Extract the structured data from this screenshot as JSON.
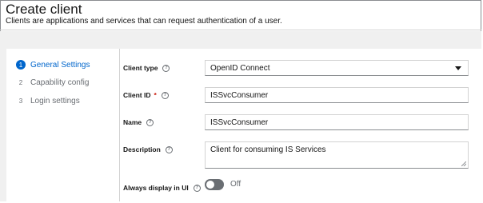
{
  "header": {
    "title": "Create client",
    "subtitle": "Clients are applications and services that can request authentication of a user."
  },
  "wizard": {
    "steps": [
      {
        "number": "1",
        "label": "General Settings",
        "active": true
      },
      {
        "number": "2",
        "label": "Capability config",
        "active": false
      },
      {
        "number": "3",
        "label": "Login settings",
        "active": false
      }
    ]
  },
  "form": {
    "client_type": {
      "label": "Client type",
      "value": "OpenID Connect"
    },
    "client_id": {
      "label": "Client ID",
      "required_mark": "*",
      "value": "ISSvcConsumer"
    },
    "name": {
      "label": "Name",
      "value": "ISSvcConsumer"
    },
    "description": {
      "label": "Description",
      "value": "Client for consuming IS Services"
    },
    "always_display": {
      "label": "Always display in UI",
      "state_text": "Off",
      "on": false
    }
  },
  "icons": {
    "help": "help-icon",
    "dropdown": "chevron-down-icon"
  },
  "colors": {
    "accent": "#0066cc",
    "required": "#c9190b",
    "toggle_off": "#6a6e73"
  }
}
